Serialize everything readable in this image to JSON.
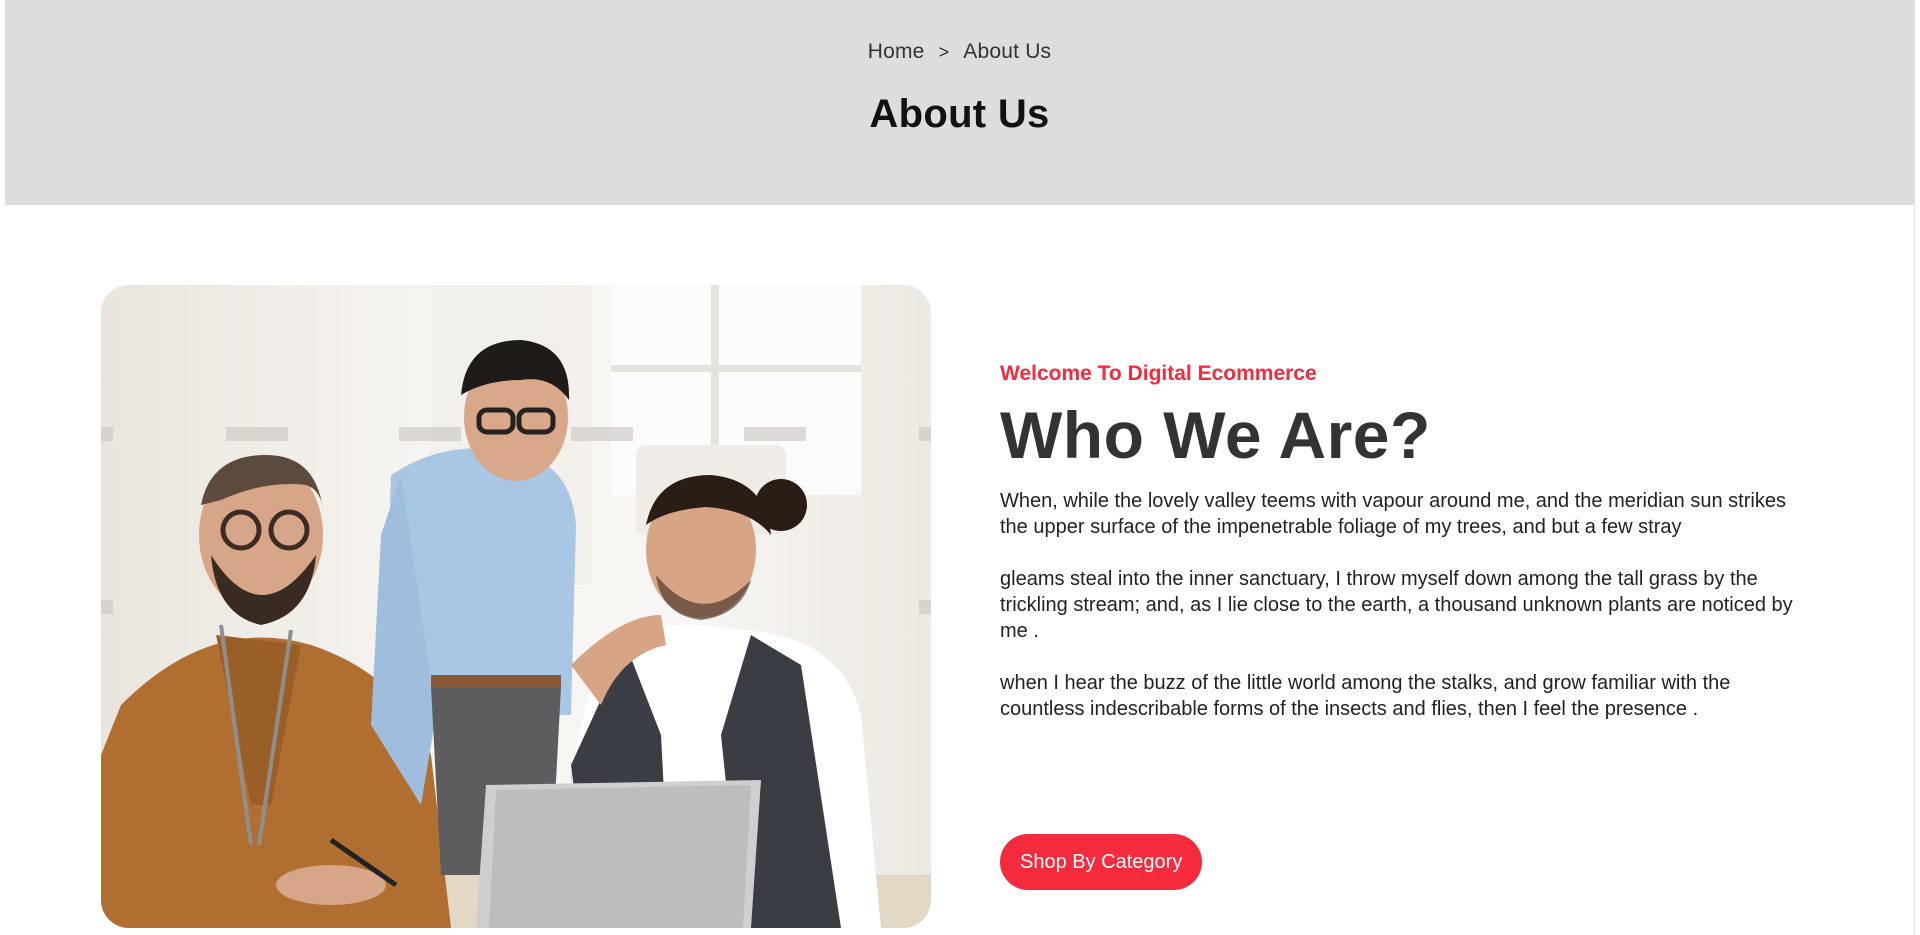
{
  "breadcrumb": {
    "home": "Home",
    "separator": ">",
    "current": "About Us"
  },
  "page_title": "About Us",
  "about": {
    "eyebrow": "Welcome To Digital Ecommerce",
    "heading": "Who We Are?",
    "paragraphs": [
      "When, while the lovely valley teems with vapour around me, and the meridian sun strikes the upper surface of the impenetrable foliage of my trees, and but a few stray",
      "gleams steal into the inner sanctuary, I throw myself down among the tall grass by the trickling stream; and, as I lie close to the earth, a thousand unknown plants are noticed by me .",
      "when I hear the buzz of the little world among the stalks, and grow familiar with the countless indescribable forms of the insects and flies, then I feel the presence ."
    ],
    "button_label": "Shop By Category"
  },
  "colors": {
    "accent": "#f42a3d",
    "banner_bg": "#dddddd",
    "heading": "#333333"
  },
  "image": {
    "subject": "team-meeting-photo"
  }
}
